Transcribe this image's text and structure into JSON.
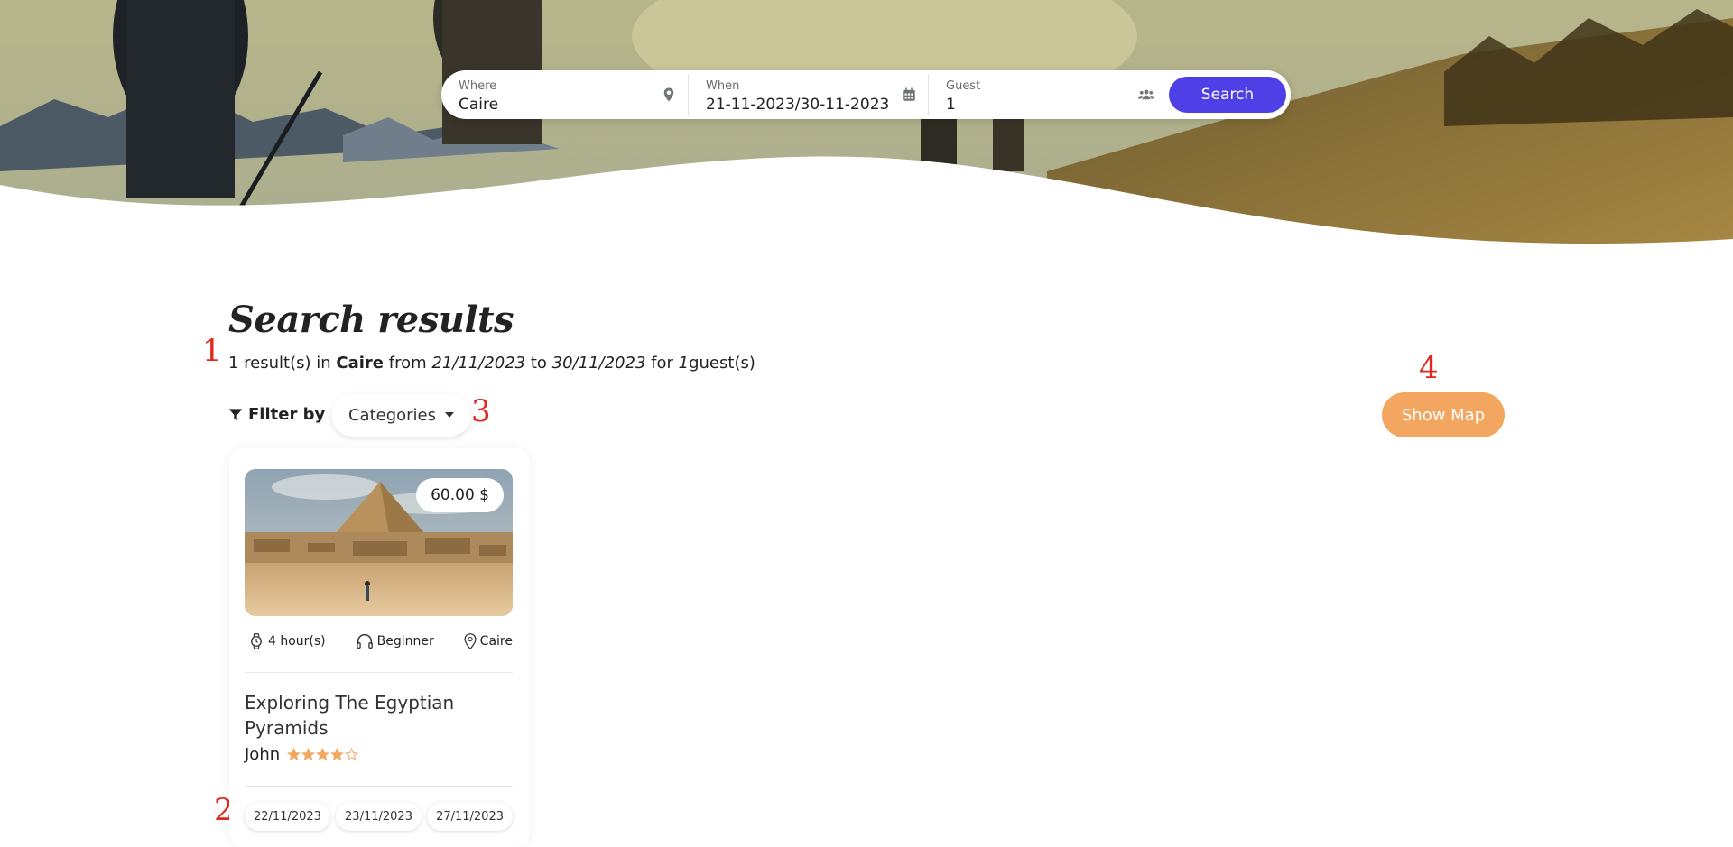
{
  "search": {
    "where_label": "Where",
    "where_value": "Caire",
    "when_label": "When",
    "when_value": "21-11-2023/30-11-2023",
    "guest_label": "Guest",
    "guest_value": "1",
    "button": "Search",
    "button_color": "#4f3fe6"
  },
  "results": {
    "title": "Search results",
    "count_text": "1 result(s) in",
    "location": "Caire",
    "from_word": "from",
    "date_from": "21/11/2023",
    "to_word": "to",
    "date_to": "30/11/2023",
    "for_word": "for",
    "guests": "1",
    "guests_suffix": "guest(s)"
  },
  "filter": {
    "label": "Filter by",
    "categories": "Categories"
  },
  "map_button": {
    "label": "Show Map",
    "color": "#f3a660"
  },
  "annotations": [
    "1",
    "2",
    "3",
    "4"
  ],
  "card": {
    "price": "60.00 $",
    "duration": "4 hour(s)",
    "level": "Beginner",
    "location": "Caire",
    "title": "Exploring The Egyptian Pyramids",
    "host": "John",
    "rating": 4,
    "rating_max": 5,
    "star_color": "#f3a660",
    "dates": [
      "22/11/2023",
      "23/11/2023",
      "27/11/2023"
    ]
  },
  "icons": [
    "map-pin-icon",
    "calendar-icon",
    "users-icon",
    "filter-icon",
    "watch-icon",
    "headset-icon",
    "location-pin-icon",
    "star-icon"
  ]
}
